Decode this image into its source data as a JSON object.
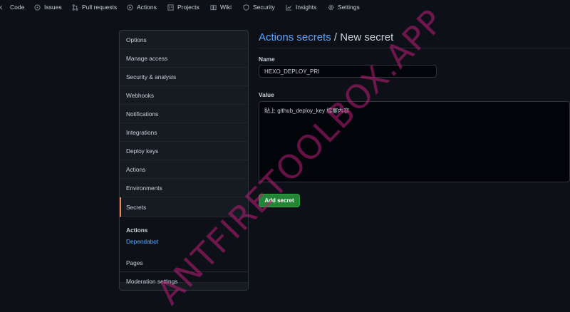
{
  "topnav": {
    "items": [
      {
        "label": "Code",
        "icon": "code-icon"
      },
      {
        "label": "Issues",
        "icon": "issue-icon"
      },
      {
        "label": "Pull requests",
        "icon": "pull-request-icon"
      },
      {
        "label": "Actions",
        "icon": "play-icon"
      },
      {
        "label": "Projects",
        "icon": "project-icon"
      },
      {
        "label": "Wiki",
        "icon": "book-icon"
      },
      {
        "label": "Security",
        "icon": "shield-icon"
      },
      {
        "label": "Insights",
        "icon": "graph-icon"
      },
      {
        "label": "Settings",
        "icon": "gear-icon"
      }
    ]
  },
  "sidebar": {
    "items": [
      {
        "label": "Options"
      },
      {
        "label": "Manage access"
      },
      {
        "label": "Security & analysis"
      },
      {
        "label": "Webhooks"
      },
      {
        "label": "Notifications"
      },
      {
        "label": "Integrations"
      },
      {
        "label": "Deploy keys"
      },
      {
        "label": "Actions"
      },
      {
        "label": "Environments"
      },
      {
        "label": "Secrets"
      }
    ],
    "selected": "Secrets",
    "group": {
      "heading": "Actions",
      "link": "Dependabot"
    },
    "bottom_items": [
      {
        "label": "Pages"
      },
      {
        "label": "Moderation settings"
      }
    ]
  },
  "main": {
    "title_link": "Actions secrets",
    "title_sep": " / ",
    "title_rest": "New secret",
    "name_label": "Name",
    "name_value": "HEXO_DEPLOY_PRI",
    "value_label": "Value",
    "value_text": "貼上 github_deploy_key 檔案內容",
    "add_button": "Add secret"
  },
  "watermark": "ANTFIRETOOLBOX.APP",
  "colors": {
    "background": "#0d1117",
    "link": "#58a6ff",
    "selected_accent": "#f78166",
    "button_green": "#238636",
    "watermark": "#be1e78"
  }
}
